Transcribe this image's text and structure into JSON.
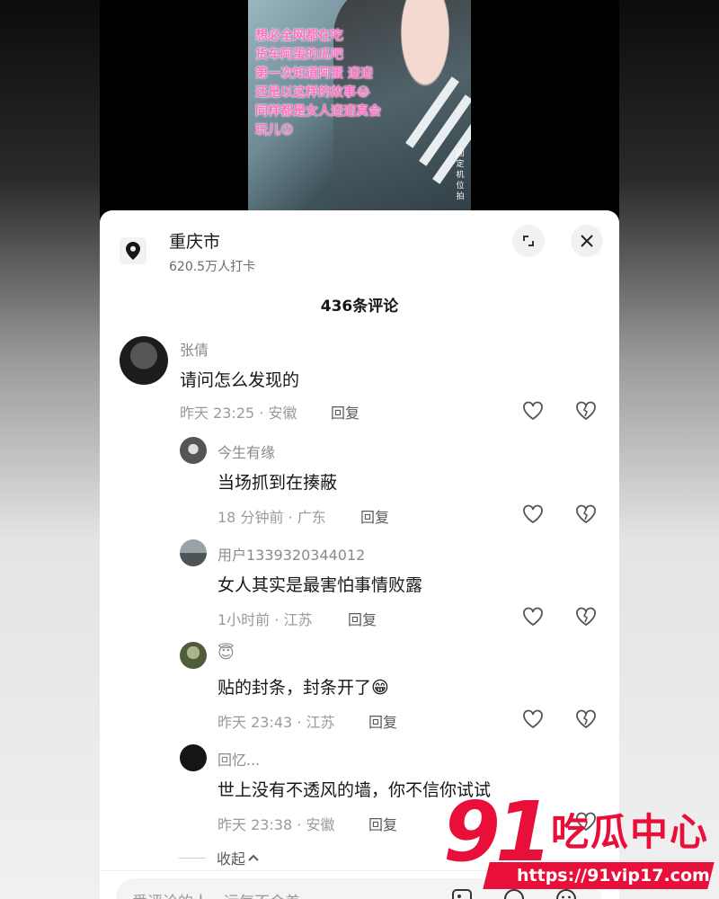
{
  "video": {
    "overlay_text": [
      "想必全网都在吃",
      "货车阿蛋的瓜吧",
      "第一次知道阿蛋 迎迎",
      "还是以这样的故事😂",
      "同样都是女人迎迎真会",
      "玩儿😝"
    ],
    "side_caption": "固定机位拍"
  },
  "location": {
    "title": "重庆市",
    "subtitle": "620.5万人打卡"
  },
  "comments_header": {
    "count_label": "436条评论"
  },
  "comments": [
    {
      "name": "张倩",
      "text": "请问怎么发现的",
      "meta": "昨天 23:25 · 安徽",
      "reply": "回复"
    },
    {
      "name": "今生有缘",
      "text": "当场抓到在揍蔽",
      "meta": "18 分钟前 · 广东",
      "reply": "回复"
    },
    {
      "name": "用户1339320344012",
      "text": "女人其实是最害怕事情败露",
      "meta": "1小时前 · 江苏",
      "reply": "回复"
    },
    {
      "name": "😇",
      "text": "贴的封条，封条开了😁",
      "meta": "昨天 23:43 · 江苏",
      "reply": "回复"
    },
    {
      "name": "回忆...",
      "text": "世上没有不透风的墙，你不信你试试",
      "meta": "昨天 23:38 · 安徽",
      "reply": "回复"
    }
  ],
  "collapse_label": "收起",
  "input": {
    "placeholder": "爱评论的人，运气不会差"
  },
  "watermark": {
    "number": "91",
    "brand": "吃瓜中心",
    "url": "https://91vip17.com"
  },
  "colors": {
    "accent_red": "#e8103b",
    "overlay_pink": "#ff6ec4"
  }
}
